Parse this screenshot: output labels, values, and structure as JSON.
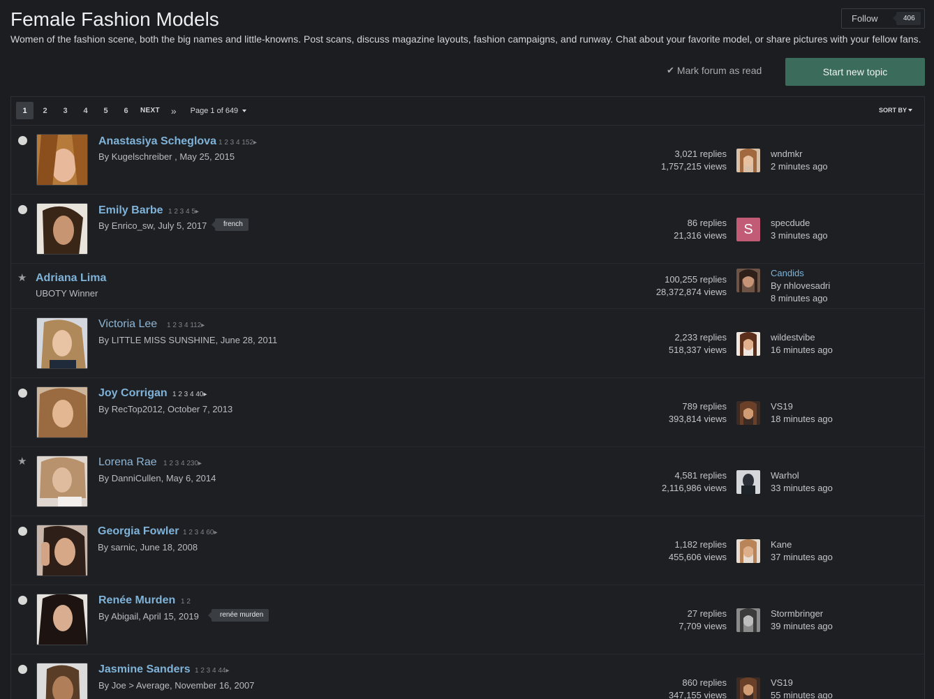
{
  "header": {
    "title": "Female Fashion Models",
    "description": "Women of the fashion scene, both the big names and little-knowns. Post scans, discuss magazine layouts, fashion campaigns, and runway. Chat about your favorite model, or share pictures with your fellow fans.",
    "follow_label": "Follow",
    "follow_count": "406",
    "mark_read": "Mark forum as read",
    "start_topic": "Start new topic"
  },
  "pagination": {
    "pages": [
      "1",
      "2",
      "3",
      "4",
      "5",
      "6"
    ],
    "next": "NEXT",
    "last": "»",
    "page_info": "Page 1 of 649",
    "sort_by": "SORT BY"
  },
  "topics": [
    {
      "title": "Anastasiya Scheglova",
      "pages": "1  2  3  4  152▸",
      "meta": "By Kugelschreiber , May 25, 2015",
      "replies": "3,021 replies",
      "views": "1,757,215 views",
      "last_user": "wndmkr",
      "last_time": "2 minutes ago"
    },
    {
      "title": "Emily Barbe",
      "pages": "1  2  3  4  5▸",
      "meta": "By Enrico_sw, July 5, 2017",
      "tag": "french",
      "replies": "86 replies",
      "views": "21,316 views",
      "last_user": "specdude",
      "last_time": "3 minutes ago",
      "avatar_letter": "S"
    },
    {
      "title": "Adriana Lima",
      "subtitle": "UBOTY Winner",
      "replies": "100,255 replies",
      "views": "28,372,874 views",
      "last_link": "Candids",
      "last_user": "By nhlovesadri",
      "last_time": "8 minutes ago"
    },
    {
      "title": "Victoria Lee",
      "pages": "1  2  3  4  112▸",
      "meta": "By LITTLE MISS SUNSHINE, June 28, 2011",
      "replies": "2,233 replies",
      "views": "518,337 views",
      "last_user": "wildestvibe",
      "last_time": "16 minutes ago"
    },
    {
      "title": "Joy Corrigan",
      "pages": "1  2  3  4  40▸",
      "meta": "By RecTop2012, October 7, 2013",
      "replies": "789 replies",
      "views": "393,814 views",
      "last_user": "VS19",
      "last_time": "18 minutes ago"
    },
    {
      "title": "Lorena Rae",
      "pages": "1  2  3  4  230▸",
      "meta": "By DanniCullen, May 6, 2014",
      "replies": "4,581 replies",
      "views": "2,116,986 views",
      "last_user": "Warhol",
      "last_time": "33 minutes ago"
    },
    {
      "title": "Georgia Fowler",
      "pages": "1  2  3  4  60▸",
      "meta": "By sarnic, June 18, 2008",
      "replies": "1,182 replies",
      "views": "455,606 views",
      "last_user": "Kane",
      "last_time": "37 minutes ago"
    },
    {
      "title": "Renée Murden",
      "pages": "1  2",
      "meta": "By Abigail, April 15, 2019",
      "tag": "renée murden",
      "replies": "27 replies",
      "views": "7,709 views",
      "last_user": "Stormbringer",
      "last_time": "39 minutes ago"
    },
    {
      "title": "Jasmine Sanders",
      "pages": "1  2  3  4  44▸",
      "meta": "By Joe > Average, November 16, 2007",
      "replies": "860 replies",
      "views": "347,155 views",
      "last_user": "VS19",
      "last_time": "55 minutes ago"
    }
  ]
}
